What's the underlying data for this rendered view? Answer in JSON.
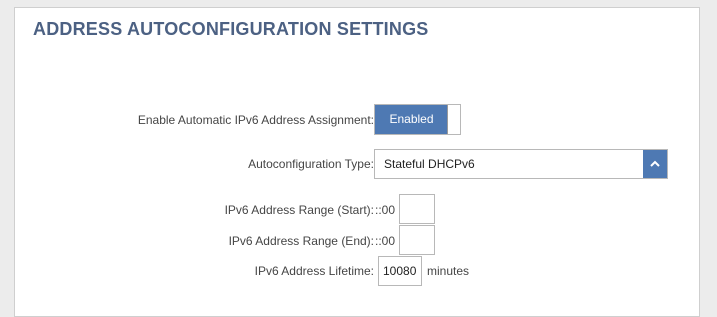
{
  "section": {
    "title": "ADDRESS AUTOCONFIGURATION SETTINGS"
  },
  "enable_auto_assignment": {
    "label": "Enable Automatic IPv6 Address Assignment:",
    "state": "Enabled"
  },
  "autoconfig_type": {
    "label": "Autoconfiguration Type:",
    "value": "Stateful DHCPv6",
    "button_icon": "chevron-up-icon"
  },
  "range_start": {
    "label": "IPv6 Address Range (Start):",
    "prefix": "::00",
    "value": ""
  },
  "range_end": {
    "label": "IPv6 Address Range (End):",
    "prefix": "::00",
    "value": ""
  },
  "lifetime": {
    "label": "IPv6 Address Lifetime:",
    "value": "10080",
    "unit": "minutes"
  },
  "colors": {
    "title": "#4c6183",
    "accent": "#4e79b3"
  }
}
